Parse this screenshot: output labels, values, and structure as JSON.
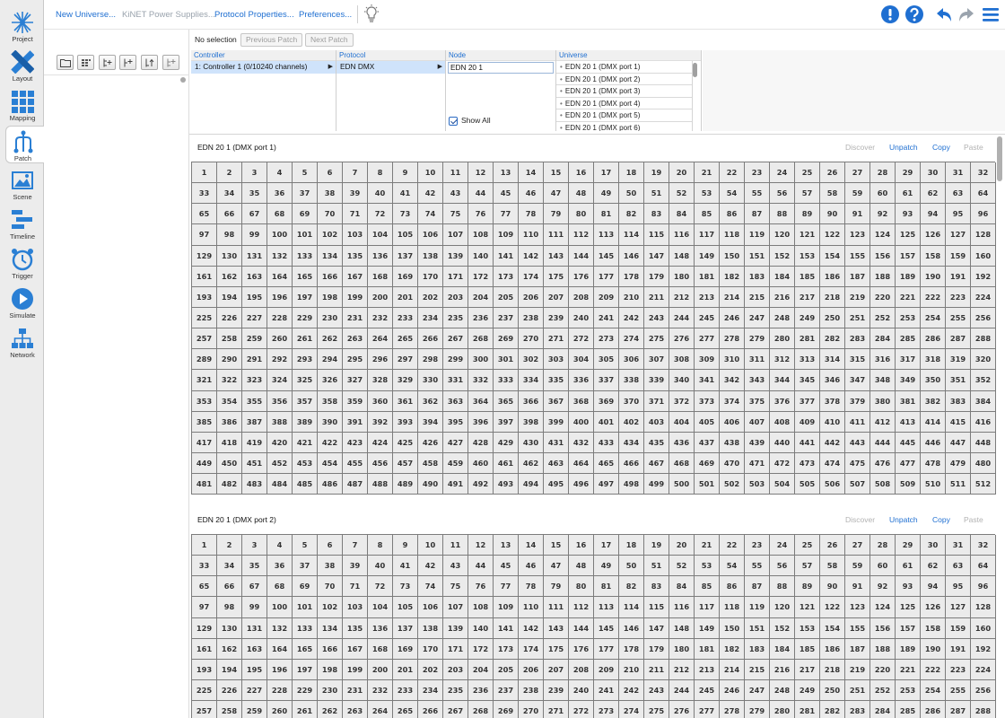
{
  "modes": [
    {
      "id": "project",
      "label": "Project",
      "icon": "project-icon",
      "active": false
    },
    {
      "id": "layout",
      "label": "Layout",
      "icon": "layout-icon",
      "active": false
    },
    {
      "id": "mapping",
      "label": "Mapping",
      "icon": "mapping-icon",
      "active": false
    },
    {
      "id": "patch",
      "label": "Patch",
      "icon": "patch-icon",
      "active": true
    },
    {
      "id": "scene",
      "label": "Scene",
      "icon": "scene-icon",
      "active": false
    },
    {
      "id": "timeline",
      "label": "Timeline",
      "icon": "timeline-icon",
      "active": false
    },
    {
      "id": "trigger",
      "label": "Trigger",
      "icon": "trigger-icon",
      "active": false
    },
    {
      "id": "simulate",
      "label": "Simulate",
      "icon": "simulate-icon",
      "active": false
    },
    {
      "id": "network",
      "label": "Network",
      "icon": "network-icon",
      "active": false
    }
  ],
  "toolbar": {
    "new_universe": "New Universe...",
    "kinet_power": "KiNET Power Supplies...",
    "protocol_props": "Protocol Properties...",
    "preferences": "Preferences...",
    "icons": [
      "lightbulb-icon",
      "alert-icon",
      "help-icon",
      "undo-icon",
      "redo-icon",
      "menu-icon"
    ]
  },
  "tree_buttons": [
    "folder-icon",
    "group-icon",
    "add-fixture-icon",
    "add-child-icon",
    "move-up-icon",
    "sort-icon"
  ],
  "selection": {
    "label": "No selection",
    "prev": "Previous Patch",
    "next": "Next Patch"
  },
  "browser": {
    "controller": {
      "header": "Controller",
      "rows": [
        "1: Controller 1 (0/10240 channels)"
      ]
    },
    "protocol": {
      "header": "Protocol",
      "rows": [
        "EDN DMX"
      ]
    },
    "node": {
      "header": "Node",
      "rows": [
        "EDN 20 1"
      ],
      "show_all": "Show All"
    },
    "universe": {
      "header": "Universe",
      "rows": [
        "EDN 20 1 (DMX port 1)",
        "EDN 20 1 (DMX port 2)",
        "EDN 20 1 (DMX port 3)",
        "EDN 20 1 (DMX port 4)",
        "EDN 20 1 (DMX port 5)",
        "EDN 20 1 (DMX port 6)"
      ]
    }
  },
  "universes": [
    {
      "title": "EDN 20 1 (DMX port 1)",
      "discover": "Discover",
      "unpatch": "Unpatch",
      "copy": "Copy",
      "paste": "Paste",
      "channel_count": 512
    },
    {
      "title": "EDN 20 1 (DMX port 2)",
      "discover": "Discover",
      "unpatch": "Unpatch",
      "copy": "Copy",
      "paste": "Paste",
      "channel_count": 288
    }
  ],
  "colors": {
    "accent": "#1f6fd1",
    "cell_bg": "#ebebeb",
    "grid_line": "#7c7c7c",
    "selected_row": "#cfe3fb"
  }
}
